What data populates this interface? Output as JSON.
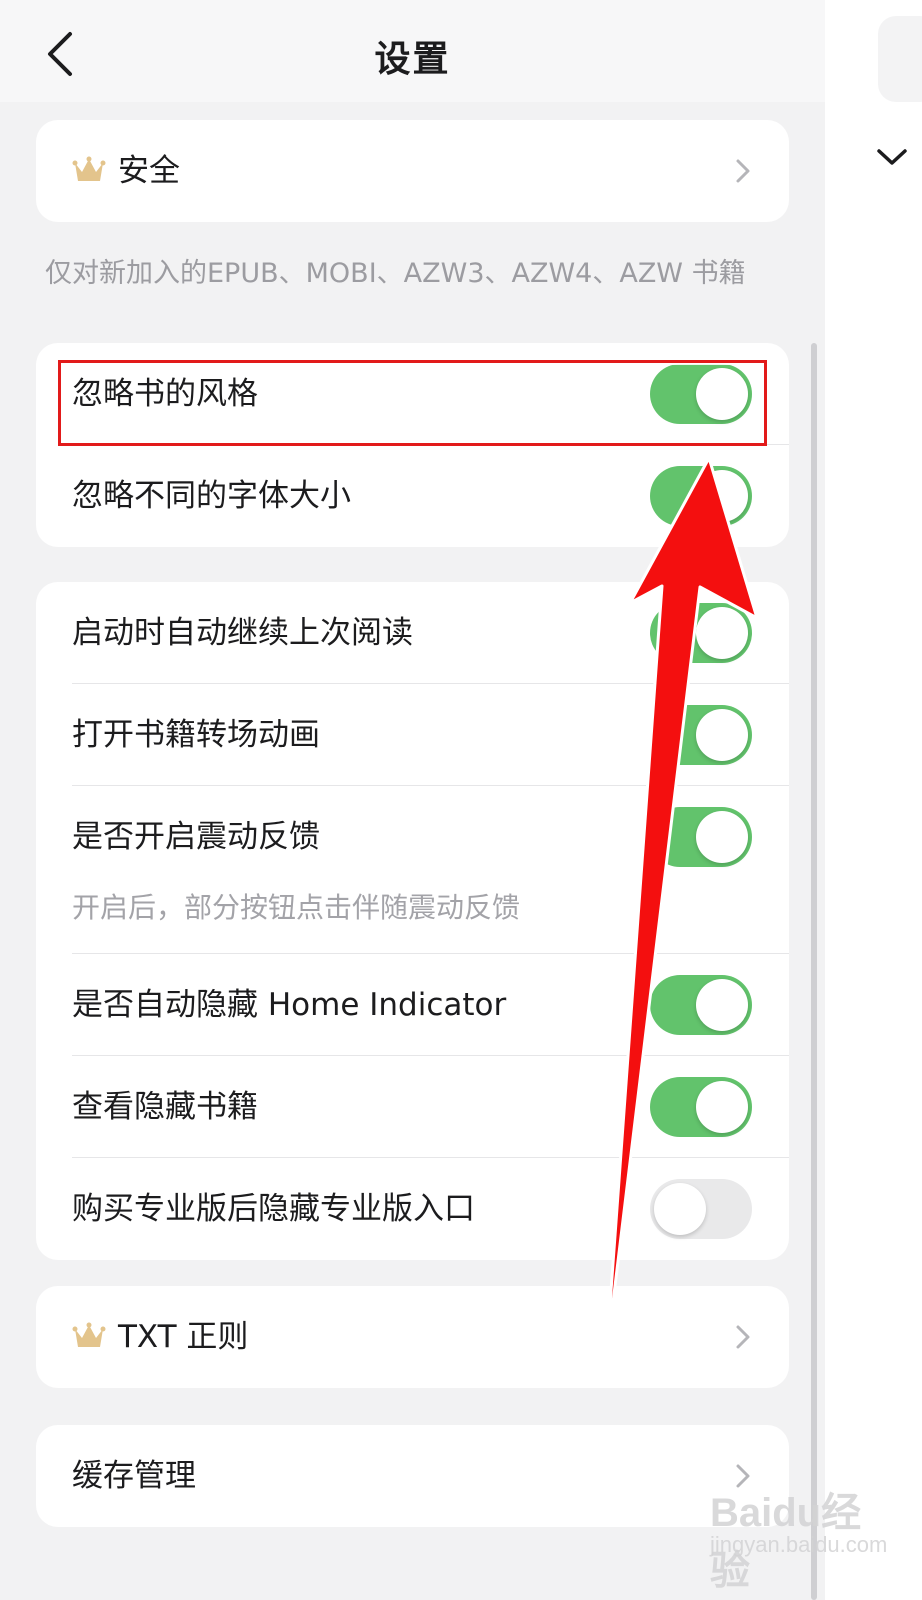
{
  "header": {
    "title": "设置"
  },
  "icons": {
    "back": "chevron-left-icon",
    "crown": "crown-icon",
    "disclosure": "chevron-right-icon"
  },
  "colors": {
    "toggle_on": "#62c36c",
    "toggle_off": "#e9e9ea",
    "annotation": "#e21a1a",
    "background": "#f2f2f3"
  },
  "security": {
    "label": "安全"
  },
  "note": {
    "text": "仅对新加入的EPUB、MOBI、AZW3、AZW4、AZW 书籍"
  },
  "group1": [
    {
      "label": "忽略书的风格",
      "on": true
    },
    {
      "label": "忽略不同的字体大小",
      "on": true
    }
  ],
  "group2": [
    {
      "label": "启动时自动继续上次阅读",
      "on": true
    },
    {
      "label": "打开书籍转场动画",
      "on": true
    },
    {
      "label": "是否开启震动反馈",
      "sub": "开启后，部分按钮点击伴随震动反馈",
      "on": true
    },
    {
      "label": "是否自动隐藏 Home Indicator",
      "on": true
    },
    {
      "label": "查看隐藏书籍",
      "on": true
    },
    {
      "label": "购买专业版后隐藏专业版入口",
      "on": false
    }
  ],
  "txt_rules": {
    "label": "TXT 正则"
  },
  "cache": {
    "label": "缓存管理"
  },
  "watermark": {
    "main": "Baidu经验",
    "sub": "jingyan.baidu.com"
  }
}
